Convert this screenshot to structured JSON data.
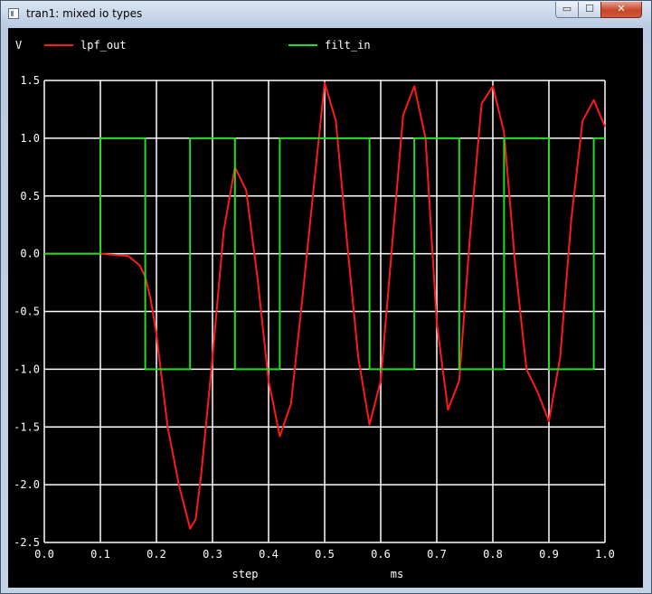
{
  "window": {
    "title": "tran1: mixed io types",
    "buttons": {
      "minimize": "▭",
      "maximize": "☐",
      "close": "✕"
    }
  },
  "colors": {
    "background": "#000000",
    "grid": "#ffffff",
    "axis_text": "#ffffff",
    "lpf_out": "#ff1a1a",
    "filt_in": "#22dd22"
  },
  "chart_data": {
    "type": "line",
    "ylabel": "V",
    "xlabel_parts": [
      "step",
      "ms"
    ],
    "xlim": [
      0.0,
      1.0
    ],
    "ylim": [
      -2.5,
      1.5
    ],
    "x_ticks": [
      "0.0",
      "0.1",
      "0.2",
      "0.3",
      "0.4",
      "0.5",
      "0.6",
      "0.7",
      "0.8",
      "0.9",
      "1.0"
    ],
    "y_ticks": [
      "1.5",
      "1.0",
      "0.5",
      "0.0",
      "-0.5",
      "-1.0",
      "-1.5",
      "-2.0",
      "-2.5"
    ],
    "grid": true,
    "legend_position": "top",
    "series": [
      {
        "name": "lpf_out",
        "color": "#ff1a1a",
        "x": [
          0.0,
          0.1,
          0.15,
          0.17,
          0.18,
          0.19,
          0.2,
          0.21,
          0.22,
          0.24,
          0.26,
          0.27,
          0.28,
          0.3,
          0.32,
          0.34,
          0.36,
          0.38,
          0.4,
          0.42,
          0.44,
          0.46,
          0.48,
          0.5,
          0.52,
          0.54,
          0.56,
          0.58,
          0.6,
          0.62,
          0.64,
          0.66,
          0.68,
          0.7,
          0.72,
          0.74,
          0.76,
          0.78,
          0.8,
          0.82,
          0.84,
          0.86,
          0.88,
          0.9,
          0.92,
          0.94,
          0.96,
          0.98,
          1.0
        ],
        "y": [
          0.0,
          0.0,
          -0.02,
          -0.1,
          -0.2,
          -0.4,
          -0.7,
          -1.1,
          -1.5,
          -2.0,
          -2.38,
          -2.3,
          -1.9,
          -0.9,
          0.2,
          0.75,
          0.55,
          -0.2,
          -1.1,
          -1.58,
          -1.3,
          -0.4,
          0.55,
          1.48,
          1.15,
          0.1,
          -0.9,
          -1.48,
          -1.1,
          0.05,
          1.2,
          1.45,
          1.0,
          -0.6,
          -1.35,
          -1.1,
          0.2,
          1.3,
          1.45,
          1.05,
          -0.1,
          -1.0,
          -1.2,
          -1.45,
          -0.9,
          0.3,
          1.15,
          1.33,
          1.1
        ]
      },
      {
        "name": "filt_in",
        "color": "#22dd22",
        "x": [
          0.0,
          0.1,
          0.1,
          0.18,
          0.18,
          0.26,
          0.26,
          0.34,
          0.34,
          0.42,
          0.42,
          0.58,
          0.58,
          0.66,
          0.66,
          0.74,
          0.74,
          0.82,
          0.82,
          0.9,
          0.9,
          0.98,
          0.98,
          1.0
        ],
        "y": [
          0.0,
          0.0,
          1.0,
          1.0,
          -1.0,
          -1.0,
          1.0,
          1.0,
          -1.0,
          -1.0,
          1.0,
          1.0,
          -1.0,
          -1.0,
          1.0,
          1.0,
          -1.0,
          -1.0,
          1.0,
          1.0,
          -1.0,
          -1.0,
          1.0,
          1.0
        ]
      }
    ]
  }
}
